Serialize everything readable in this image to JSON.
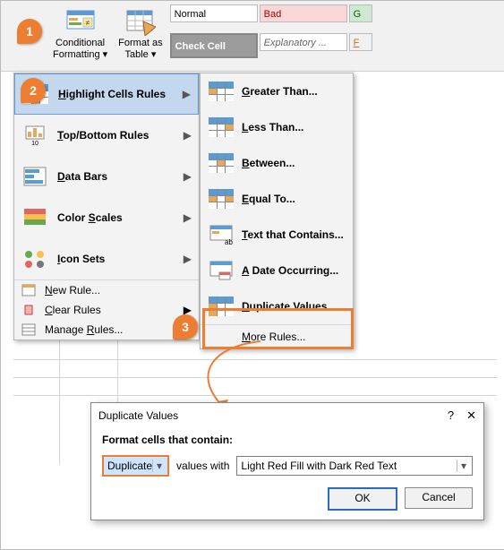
{
  "ribbon": {
    "cond_format": {
      "line1": "Conditional",
      "line2": "Formatting"
    },
    "format_table": {
      "line1": "Format as",
      "line2": "Table"
    },
    "styles": {
      "normal": "Normal",
      "bad": "Bad",
      "good": "G",
      "check": "Check Cell",
      "explanatory": "Explanatory ...",
      "link": "F"
    }
  },
  "menu1": {
    "items": [
      {
        "label": "Highlight Cells Rules",
        "u": "H"
      },
      {
        "label": "Top/Bottom Rules",
        "u": "T"
      },
      {
        "label": "Data Bars",
        "u": "D"
      },
      {
        "label": "Color Scales",
        "u": "S"
      },
      {
        "label": "Icon Sets",
        "u": "I"
      }
    ],
    "small": [
      {
        "label": "New Rule...",
        "u": "N"
      },
      {
        "label": "Clear Rules",
        "u": "C"
      },
      {
        "label": "Manage Rules...",
        "u": "R"
      }
    ]
  },
  "menu2": {
    "items": [
      {
        "label": "Greater Than...",
        "u": "G"
      },
      {
        "label": "Less Than...",
        "u": "L"
      },
      {
        "label": "Between...",
        "u": "B"
      },
      {
        "label": "Equal To...",
        "u": "E"
      },
      {
        "label": "Text that Contains...",
        "u": "T"
      },
      {
        "label": "A Date Occurring...",
        "u": "A"
      },
      {
        "label": "Duplicate Values...",
        "u": "D"
      }
    ],
    "more": "More Rules...",
    "more_u": "M"
  },
  "steps": {
    "s1": "1",
    "s2": "2",
    "s3": "3"
  },
  "dialog": {
    "title": "Duplicate Values",
    "header": "Format cells that contain:",
    "type": "Duplicate",
    "mid": "values with",
    "format": "Light Red Fill with Dark Red Text",
    "ok": "OK",
    "cancel": "Cancel"
  }
}
